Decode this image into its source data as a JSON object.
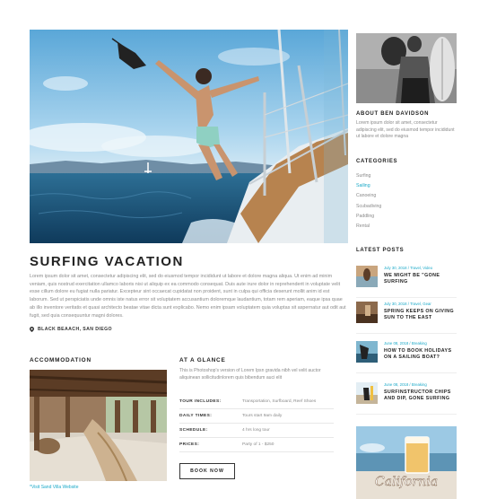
{
  "post": {
    "title": "SURFING VACATION",
    "body": "Lorem ipsum dolor sit amet, consectetur adipiscing elit, sed do eiusmod tempor incididunt ut labore et dolore magna aliqua. Ut enim ad minim veniam, quis nostrud exercitation ullamco laboris nisi ut aliquip ex ea commodo consequat. Duis aute irure dolor in reprehenderit in voluptate velit esse cillum dolore eu fugiat nulla pariatur. Excepteur sint occaecat cupidatat non proident, sunt in culpa qui officia deserunt mollit anim id est laborum. Sed ut perspiciatis unde omnis iste natus error sit voluptatem accusantium doloremque laudantium, totam rem aperiam, eaque ipsa quae ab illo inventore veritatis et quasi architecto beatae vitae dicta sunt explicabo. Nemo enim ipsam voluptatem quia voluptas sit aspernatur aut odit aut fugit, sed quia consequuntur magni dolores.",
    "location": "BLACK BEAACH, SAN DIEGO",
    "location_icon": "map-pin-icon"
  },
  "accommodation": {
    "heading": "ACCOMMODATION",
    "link": "*Visit Sand Villa Website"
  },
  "glance": {
    "heading": "AT A GLANCE",
    "intro": "This is Photoshop's version  of Lorem Ipsn gravida nibh vel velit auctor aliquinean sollicitudinlorem quis bibendum auci elit",
    "rows": [
      {
        "key": "TOUR INCLUDES:",
        "value": "Transportation, Surfboard, Reef Shoes"
      },
      {
        "key": "DAILY TIMES:",
        "value": "Tours start 9am daily"
      },
      {
        "key": "SCHEDULE:",
        "value": "4 hrs long tour"
      },
      {
        "key": "PRICES:",
        "value": "Party of 1 - $250"
      }
    ],
    "button": "BOOK NOW"
  },
  "about": {
    "heading": "ABOUT BEN DAVIDSON",
    "text": "Lorem ipsum dolor sit amet, consectetur adipiscing elit, sed do eiusmod tempor incididunt ut labore et dolore magna"
  },
  "categories": {
    "heading": "CATEGORIES",
    "items": [
      "Surfing",
      "Sailing",
      "Canoeing",
      "Scubadiving",
      "Paddling",
      "Rental"
    ],
    "active_index": 1
  },
  "latest_posts": {
    "heading": "LATEST POSTS",
    "items": [
      {
        "meta": "July 30, 2018 / Travel, Video",
        "title": "WE MIGHT BE \"GONE SURFING"
      },
      {
        "meta": "July 30, 2018 / Travel, Gear",
        "title": "SPRING KEEPS ON GIVING SUN TO THE EAST"
      },
      {
        "meta": "June 08, 2018 / Breaking",
        "title": "HOW TO BOOK HOLIDAYS ON A SAILING BOAT?"
      },
      {
        "meta": "June 08, 2018 / Breaking",
        "title": "SURFINSTRUCTOR CHIPS AND DIP, GONE SURFING"
      }
    ]
  },
  "promo": {
    "script_text": "California"
  },
  "colors": {
    "accent": "#1ba9c8",
    "heading": "#222222",
    "muted": "#8a8a8a"
  }
}
